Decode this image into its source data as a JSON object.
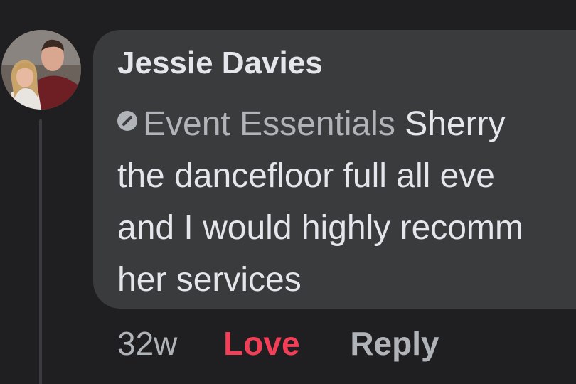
{
  "comment": {
    "author": "Jessie Davies",
    "tag_label": "Event Essentials",
    "text_lines": [
      "Sherry",
      "the dancefloor full all eve",
      "and I would highly recomm",
      "her services"
    ],
    "timestamp": "32w",
    "reaction_label": "Love",
    "reply_label": "Reply"
  },
  "icons": {
    "avatar": "profile-photo",
    "tag": "slash-circle-icon"
  },
  "colors": {
    "background": "#1f1f21",
    "bubble": "#3a3b3d",
    "primary_text": "#e4e6eb",
    "secondary_text": "#b0b3b8",
    "love": "#f33e58"
  }
}
